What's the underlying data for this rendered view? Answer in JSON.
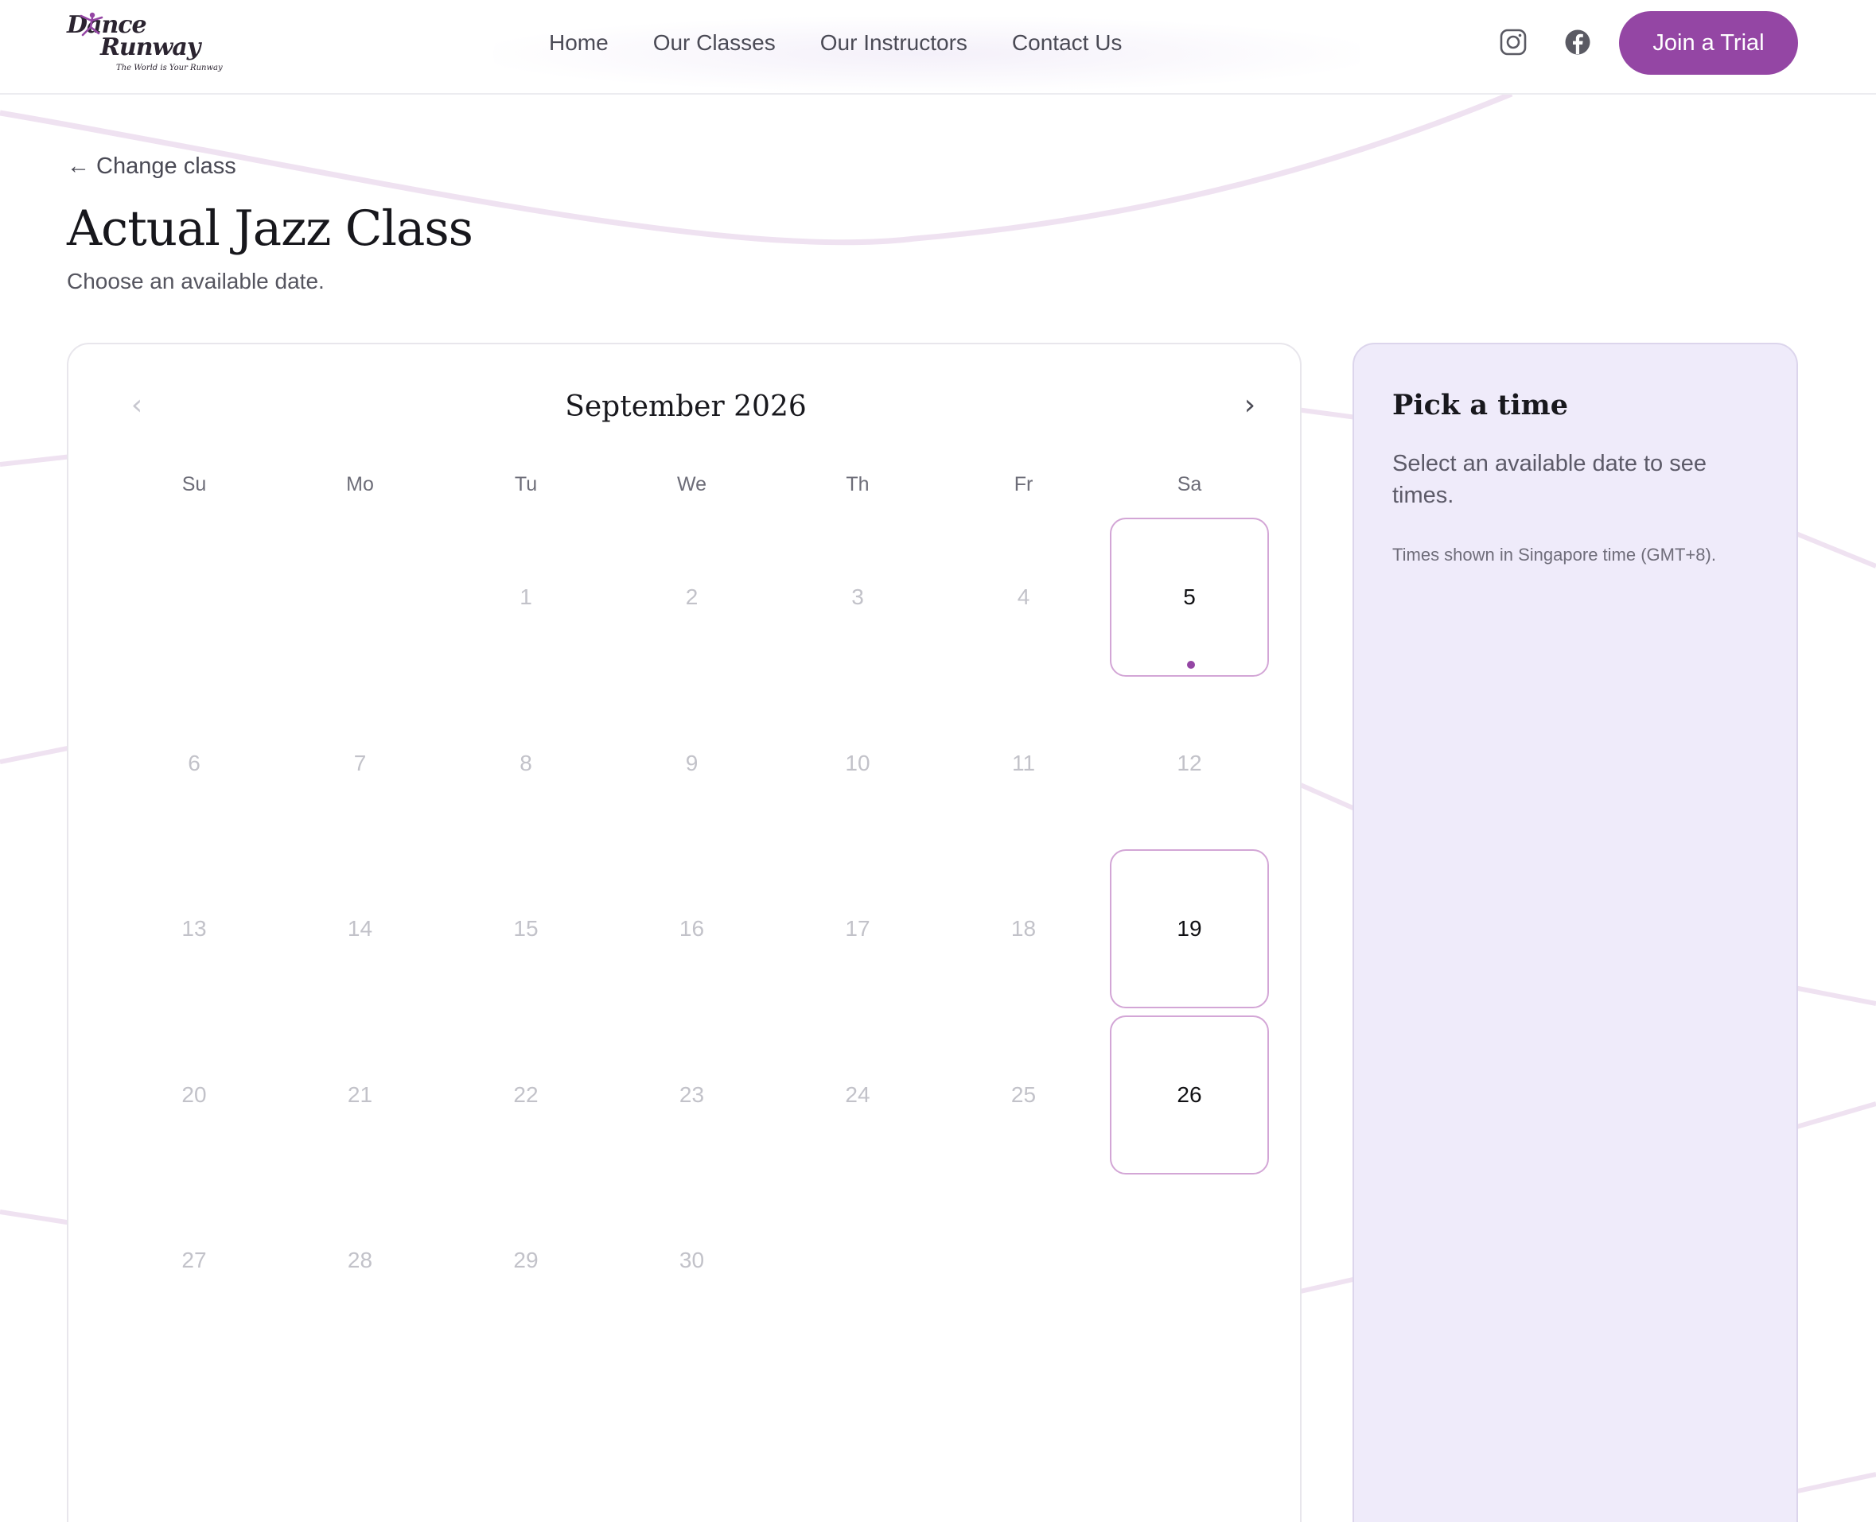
{
  "brand": {
    "logo_line1": "Dance",
    "logo_line2": "Runway",
    "logo_tagline": "The World is Your Runway"
  },
  "nav": {
    "links": [
      "Home",
      "Our Classes",
      "Our Instructors",
      "Contact Us"
    ],
    "social_icons": [
      "instagram-icon",
      "facebook-icon"
    ],
    "cta_label": "Join a Trial"
  },
  "page": {
    "back_label": "← Change class",
    "title": "Actual Jazz Class",
    "subtitle": "Choose an available date."
  },
  "calendar": {
    "month_label": "September 2026",
    "prev_icon": "‹",
    "next_icon": "›",
    "weekdays": [
      "Su",
      "Mo",
      "Tu",
      "We",
      "Th",
      "Fr",
      "Sa"
    ],
    "first_weekday_index": 2,
    "days_in_month": 30,
    "available_dates": [
      5,
      19,
      26
    ],
    "marked_date": 5
  },
  "side_panel": {
    "title": "Pick a time",
    "message": "Select an available date to see times.",
    "timezone_note": "Times shown in Singapore time (GMT+8)."
  },
  "colors": {
    "accent": "#9446a4",
    "available_border": "#d3a6d6",
    "panel_bg": "#efebfa",
    "curve": "#efe2f1"
  }
}
